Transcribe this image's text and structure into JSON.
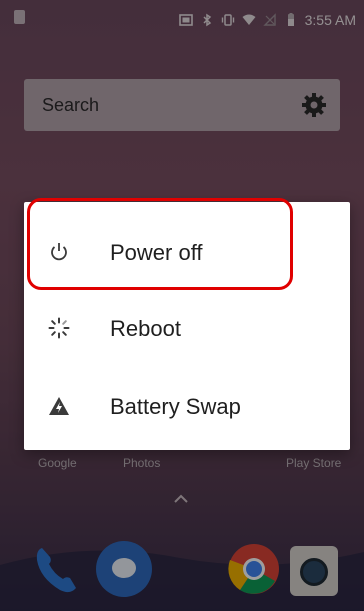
{
  "status_bar": {
    "time": "3:55 AM",
    "icons": [
      "sim-card-icon",
      "screenshot-icon",
      "bluetooth-icon",
      "vibrate-icon",
      "wifi-icon",
      "no-signal-icon",
      "battery-icon"
    ]
  },
  "search_bar": {
    "label": "Search",
    "icon": "gear-icon"
  },
  "power_menu": {
    "items": [
      {
        "label": "Power off",
        "icon": "power-icon"
      },
      {
        "label": "Reboot",
        "icon": "reboot-icon"
      },
      {
        "label": "Battery Swap",
        "icon": "battery-swap-icon"
      }
    ]
  },
  "home": {
    "app_labels": [
      "Google",
      "Photos",
      "Play Store"
    ]
  },
  "dock": {
    "apps": [
      "phone-icon",
      "messages-icon",
      "chrome-icon",
      "camera-icon"
    ]
  },
  "colors": {
    "highlight": "#e00000",
    "dialog_background": "#ffffff"
  }
}
